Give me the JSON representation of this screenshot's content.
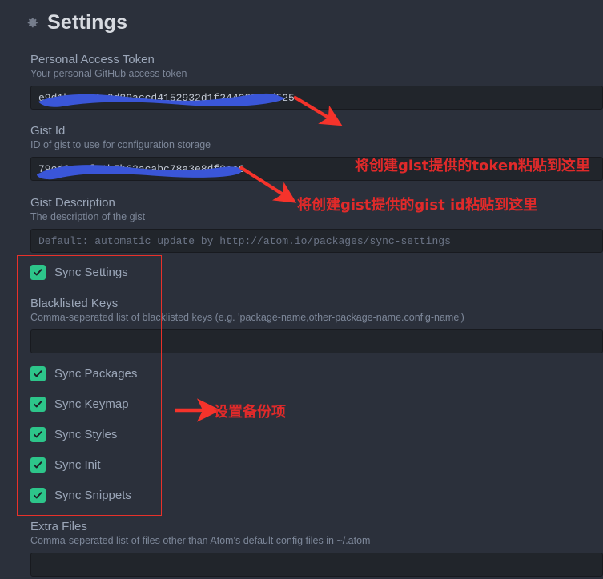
{
  "window": {
    "background": "#2b303b",
    "input_background": "#21252b",
    "accent_green": "#2dc58a",
    "annotation_red": "#e8312a",
    "redaction_blue": "#3a56d8"
  },
  "header": {
    "icon": "gear-icon",
    "title": "Settings"
  },
  "fields": [
    {
      "name": "personal-access-token",
      "title": "Personal Access Token",
      "description": "Your personal GitHub access token",
      "value": "e9d1bcc241c9d89accd4152932d1f2442875ad525",
      "placeholder": "",
      "redacted": true
    },
    {
      "name": "gist-id",
      "title": "Gist Id",
      "description": "ID of gist to use for configuration storage",
      "value": "79cd2c82fc1b5b62acabc78a3e8df9ee6",
      "placeholder": "",
      "redacted": true
    },
    {
      "name": "gist-description",
      "title": "Gist Description",
      "description": "The description of the gist",
      "value": "",
      "placeholder": "Default: automatic update by http://atom.io/packages/sync-settings",
      "redacted": false
    },
    {
      "name": "blacklisted-keys",
      "title": "Blacklisted Keys",
      "description": "Comma-seperated list of blacklisted keys (e.g. 'package-name,other-package-name.config-name')",
      "value": "",
      "placeholder": "",
      "redacted": false
    },
    {
      "name": "extra-files",
      "title": "Extra Files",
      "description": "Comma-seperated list of files other than Atom's default config files in ~/.atom",
      "value": "",
      "placeholder": "",
      "redacted": false
    }
  ],
  "checkboxes": [
    {
      "name": "sync-settings",
      "label": "Sync Settings",
      "checked": true
    },
    {
      "name": "sync-packages",
      "label": "Sync Packages",
      "checked": true
    },
    {
      "name": "sync-keymap",
      "label": "Sync Keymap",
      "checked": true
    },
    {
      "name": "sync-styles",
      "label": "Sync Styles",
      "checked": true
    },
    {
      "name": "sync-init",
      "label": "Sync Init",
      "checked": true
    },
    {
      "name": "sync-snippets",
      "label": "Sync Snippets",
      "checked": true
    }
  ],
  "annotations": {
    "token_note": "将创建gist提供的token粘贴到这里",
    "gist_id_note": "将创建gist提供的gist id粘贴到这里",
    "backup_items_note": "设置备份项"
  }
}
